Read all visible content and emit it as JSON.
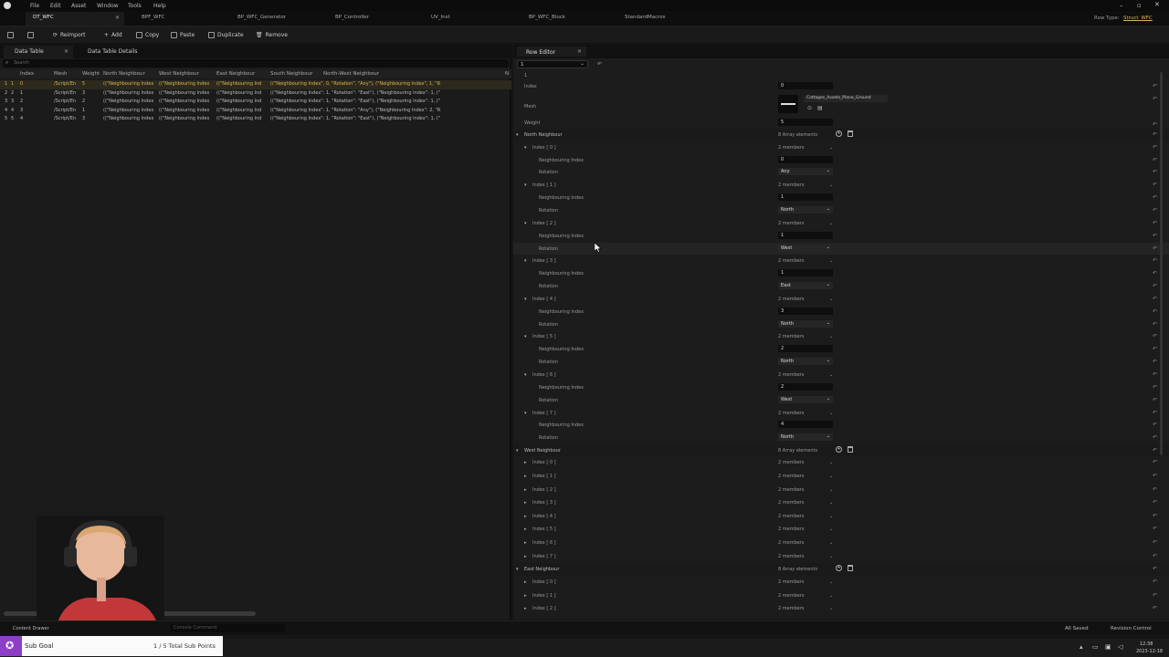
{
  "menu": [
    "File",
    "Edit",
    "Asset",
    "Window",
    "Tools",
    "Help"
  ],
  "row_type": {
    "label": "Row Type:",
    "value": "Struct_WFC"
  },
  "doc_tabs": [
    "DT_WFC",
    "BPF_WFC",
    "BP_WFC_Generator",
    "BP_Controller",
    "UV_Inst",
    "BP_WFC_Block",
    "StandardMacros"
  ],
  "toolbar": {
    "reimport": "Reimport",
    "add": "Add",
    "copy": "Copy",
    "paste": "Paste",
    "duplicate": "Duplicate",
    "remove": "Remove"
  },
  "left_tabs": {
    "data_table": "Data Table",
    "details": "Data Table Details"
  },
  "search_placeholder": "Search",
  "columns": [
    "Index",
    "Mesh",
    "Weight",
    "North Neighbour",
    "West Neighbour",
    "East Neighbour",
    "South Neighbour",
    "North-West Neighbour",
    "N"
  ],
  "rows": [
    {
      "n": "1",
      "name": "1",
      "index": "0",
      "mesh": "/Script/En",
      "weight": "5",
      "north": "((\"Neighbouring Index",
      "west": "((\"Neighbouring Index",
      "east": "((\"Neighbouring Ind",
      "south": "((\"Neighbouring Index\", 0, \"Rotation\", \"Any\"), (\"Neighbouring Index\", 1, \"R"
    },
    {
      "n": "2",
      "name": "2",
      "index": "1",
      "mesh": "/Script/En",
      "weight": "3",
      "north": "((\"Neighbouring Index",
      "west": "((\"Neighbouring Index",
      "east": "((\"Neighbouring Ind",
      "south": "((\"Neighbouring Index\": 1, \"Rotation\": \"East\"), (\"Neighbouring Index\": 1, (\""
    },
    {
      "n": "3",
      "name": "3",
      "index": "2",
      "mesh": "/Script/En",
      "weight": "2",
      "north": "((\"Neighbouring Index",
      "west": "((\"Neighbouring Index",
      "east": "((\"Neighbouring Ind",
      "south": "((\"Neighbouring Index\": 1, \"Rotation\": \"East\"), (\"Neighbouring Index\": 1, (\""
    },
    {
      "n": "4",
      "name": "4",
      "index": "3",
      "mesh": "/Script/En",
      "weight": "1",
      "north": "((\"Neighbouring Index",
      "west": "((\"Neighbouring Index",
      "east": "((\"Neighbouring Ind",
      "south": "((\"Neighbouring Index\": 1, \"Rotation\": \"Any\"), (\"Neighbouring Index\": 2, \"R"
    },
    {
      "n": "5",
      "name": "5",
      "index": "4",
      "mesh": "/Script/En",
      "weight": "3",
      "north": "((\"Neighbouring Index",
      "west": "((\"Neighbouring Index",
      "east": "((\"Neighbouring Ind",
      "south": "((\"Neighbouring Index\": 1, \"Rotation\": \"East\"), (\"Neighbouring Index\": 1, (\""
    }
  ],
  "row_editor": {
    "tab": "Row Editor",
    "row_name": "1",
    "section": "1",
    "index_label": "Index",
    "index_value": "0",
    "mesh_label": "Mesh",
    "mesh_asset": "Cottages_Assets_Plane_Ground",
    "weight_label": "Weight",
    "weight_value": "5",
    "north_label": "North Neighbour",
    "north_count": "8 Array elements",
    "west_label": "West Neighbour",
    "west_count": "8 Array elements",
    "east_label": "East Neighbour",
    "east_count": "8 Array elements",
    "members": "2 members",
    "ni_label": "Neighbouring Index",
    "rot_label": "Rotation",
    "north_items": [
      {
        "idx": "Index [ 0 ]",
        "ni": "0",
        "rot": "Any"
      },
      {
        "idx": "Index [ 1 ]",
        "ni": "1",
        "rot": "North"
      },
      {
        "idx": "Index [ 2 ]",
        "ni": "1",
        "rot": "West"
      },
      {
        "idx": "Index [ 3 ]",
        "ni": "1",
        "rot": "East"
      },
      {
        "idx": "Index [ 4 ]",
        "ni": "3",
        "rot": "North"
      },
      {
        "idx": "Index [ 5 ]",
        "ni": "2",
        "rot": "North"
      },
      {
        "idx": "Index [ 6 ]",
        "ni": "2",
        "rot": "West"
      },
      {
        "idx": "Index [ 7 ]",
        "ni": "4",
        "rot": "North"
      }
    ],
    "west_items": [
      "Index [ 0 ]",
      "Index [ 1 ]",
      "Index [ 2 ]",
      "Index [ 3 ]",
      "Index [ 4 ]",
      "Index [ 5 ]",
      "Index [ 6 ]",
      "Index [ 7 ]"
    ],
    "east_items": [
      "Index [ 0 ]",
      "Index [ 1 ]",
      "Index [ 2 ]"
    ]
  },
  "status": {
    "content_drawer": "Content Drawer",
    "console": "Console Command",
    "all_saved": "All Saved",
    "revision": "Revision Control"
  },
  "subgoal": {
    "label": "Sub Goal",
    "points": "1 / 5 Total Sub Points"
  },
  "taskbar": {
    "time": "12:38",
    "date": "2023-12-18"
  }
}
